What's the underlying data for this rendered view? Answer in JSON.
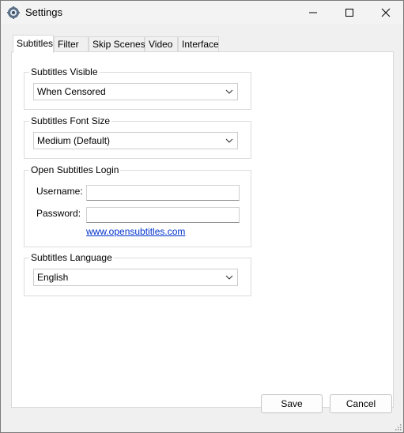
{
  "window": {
    "title": "Settings"
  },
  "tabs": [
    {
      "label": "Subtitles",
      "active": true
    },
    {
      "label": "Filter",
      "active": false
    },
    {
      "label": "Skip Scenes",
      "active": false
    },
    {
      "label": "Video",
      "active": false
    },
    {
      "label": "Interface",
      "active": false
    }
  ],
  "subtitles_visible": {
    "legend": "Subtitles Visible",
    "value": "When Censored"
  },
  "font_size": {
    "legend": "Subtitles Font Size",
    "value": "Medium (Default)"
  },
  "login": {
    "legend": "Open Subtitles Login",
    "username_label": "Username:",
    "username_value": "",
    "password_label": "Password:",
    "password_value": "",
    "link": "www.opensubtitles.com"
  },
  "language": {
    "legend": "Subtitles Language",
    "value": "English"
  },
  "footer": {
    "save": "Save",
    "cancel": "Cancel"
  },
  "colors": {
    "link": "#0033cc",
    "panel": "#ffffff",
    "chrome": "#f0f0f0"
  }
}
